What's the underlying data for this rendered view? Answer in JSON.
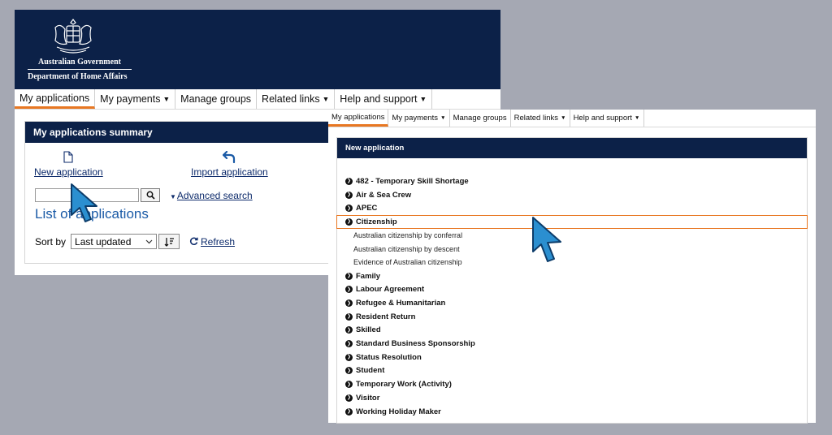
{
  "back_window": {
    "agency": {
      "line1": "Australian Government",
      "line2": "Department of Home Affairs"
    },
    "nav": [
      {
        "label": "My applications",
        "active": true,
        "dropdown": false
      },
      {
        "label": "My payments",
        "active": false,
        "dropdown": true
      },
      {
        "label": "Manage groups",
        "active": false,
        "dropdown": false
      },
      {
        "label": "Related links",
        "active": false,
        "dropdown": true
      },
      {
        "label": "Help and support",
        "active": false,
        "dropdown": true
      }
    ],
    "summary": {
      "title": "My applications summary",
      "new_application": "New application",
      "import_application": "Import application",
      "search_value": "",
      "advanced_search": "Advanced search",
      "list_title": "List of applications",
      "sort_label": "Sort by",
      "sort_value": "Last updated",
      "refresh": "Refresh"
    }
  },
  "front_window": {
    "nav": [
      {
        "label": "My applications",
        "active": true,
        "dropdown": false
      },
      {
        "label": "My payments",
        "active": false,
        "dropdown": true
      },
      {
        "label": "Manage groups",
        "active": false,
        "dropdown": false
      },
      {
        "label": "Related links",
        "active": false,
        "dropdown": true
      },
      {
        "label": "Help and support",
        "active": false,
        "dropdown": true
      }
    ],
    "new_application": {
      "title": "New application",
      "items": [
        {
          "label": "482 - Temporary Skill Shortage",
          "type": "category"
        },
        {
          "label": "Air & Sea Crew",
          "type": "category"
        },
        {
          "label": "APEC",
          "type": "category"
        },
        {
          "label": "Citizenship",
          "type": "category",
          "highlighted": true
        },
        {
          "label": "Australian citizenship by conferral",
          "type": "sub"
        },
        {
          "label": "Australian citizenship by descent",
          "type": "sub"
        },
        {
          "label": "Evidence of Australian citizenship",
          "type": "sub"
        },
        {
          "label": "Family",
          "type": "category"
        },
        {
          "label": "Labour Agreement",
          "type": "category"
        },
        {
          "label": "Refugee & Humanitarian",
          "type": "category"
        },
        {
          "label": "Resident Return",
          "type": "category"
        },
        {
          "label": "Skilled",
          "type": "category"
        },
        {
          "label": "Standard Business Sponsorship",
          "type": "category"
        },
        {
          "label": "Status Resolution",
          "type": "category"
        },
        {
          "label": "Student",
          "type": "category"
        },
        {
          "label": "Temporary Work (Activity)",
          "type": "category"
        },
        {
          "label": "Visitor",
          "type": "category"
        },
        {
          "label": "Working Holiday Maker",
          "type": "category"
        }
      ]
    }
  },
  "colors": {
    "navy": "#0c2148",
    "accent_orange": "#e87722",
    "link_blue": "#0d2b6b",
    "cursor_blue": "#2b8fd0",
    "background": "#a5a8b3"
  },
  "icons": {
    "crest": "coat-of-arms-icon",
    "new_application": "document-icon",
    "import_application": "import-arrow-icon",
    "search": "search-icon",
    "sort_direction": "sort-descending-icon",
    "refresh": "refresh-icon",
    "cursor": "pointer-cursor-icon"
  }
}
